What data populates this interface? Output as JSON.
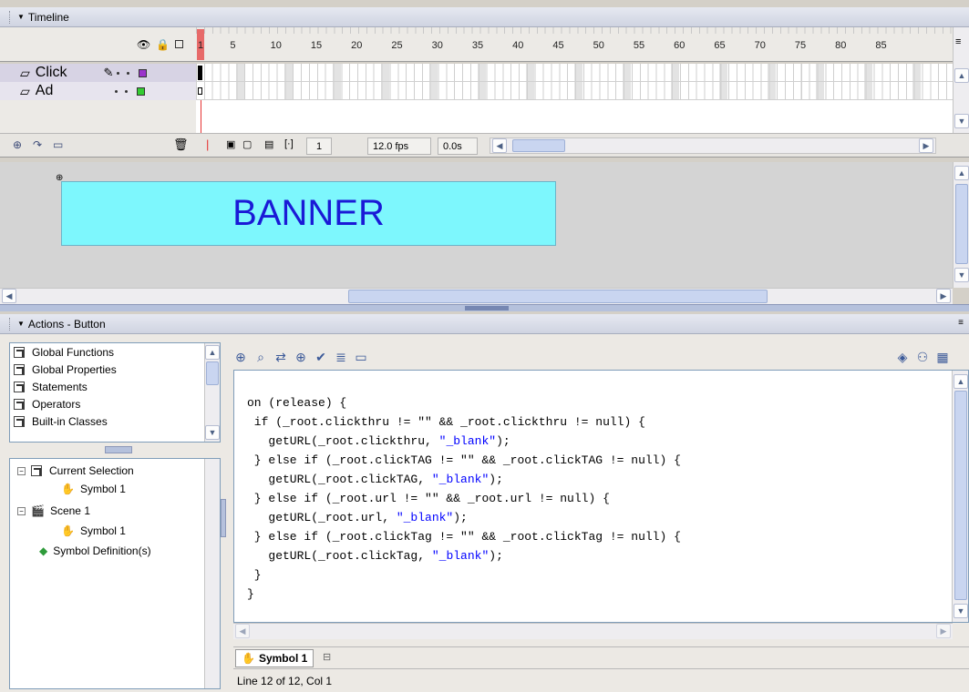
{
  "timeline": {
    "title": "Timeline",
    "ticks": [
      "1",
      "5",
      "10",
      "15",
      "20",
      "25",
      "30",
      "35",
      "40",
      "45",
      "50",
      "55",
      "60",
      "65",
      "70",
      "75",
      "80",
      "85"
    ],
    "layers": [
      {
        "name": "Click",
        "color": "#9b33cc"
      },
      {
        "name": "Ad",
        "color": "#33cc33"
      }
    ],
    "current_frame": "1",
    "fps": "12.0 fps",
    "elapsed": "0.0s"
  },
  "stage": {
    "banner_text": "BANNER"
  },
  "actions": {
    "title": "Actions - Button",
    "toolbox": [
      "Global Functions",
      "Global Properties",
      "Statements",
      "Operators",
      "Built-in Classes"
    ],
    "tree": {
      "current_selection": "Current Selection",
      "symbol1_a": "Symbol 1",
      "scene1": "Scene 1",
      "symbol1_b": "Symbol 1",
      "symbol_defs": "Symbol Definition(s)"
    },
    "code": {
      "l1_a": "on (release) {",
      "l2_a": " if (_root.clickthru != \"\" && _root.clickthru != null) {",
      "l3_a": "   getURL(_root.clickthru, ",
      "l3_s": "\"_blank\"",
      "l3_b": ");",
      "l4_a": " } else if (_root.clickTAG != \"\" && _root.clickTAG != null) {",
      "l5_a": "   getURL(_root.clickTAG, ",
      "l5_s": "\"_blank\"",
      "l5_b": ");",
      "l6_a": " } else if (_root.url != \"\" && _root.url != null) {",
      "l7_a": "   getURL(_root.url, ",
      "l7_s": "\"_blank\"",
      "l7_b": ");",
      "l8_a": " } else if (_root.clickTag != \"\" && _root.clickTag != null) {",
      "l9_a": "   getURL(_root.clickTag, ",
      "l9_s": "\"_blank\"",
      "l9_b": ");",
      "l10": " }",
      "l11": "}"
    },
    "tab_label": "Symbol 1",
    "status": "Line 12 of 12, Col 1"
  }
}
